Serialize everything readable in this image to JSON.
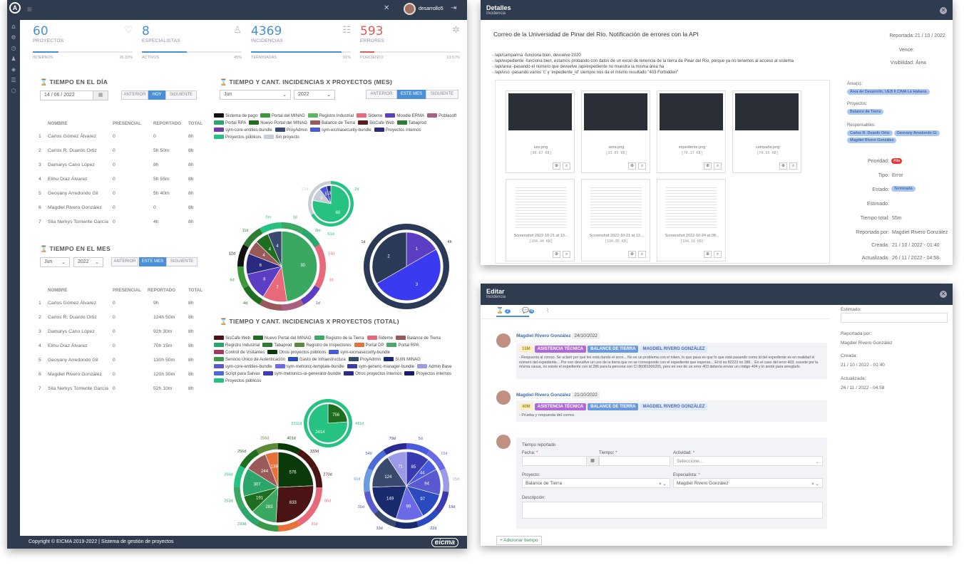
{
  "dashboard": {
    "user": "desarrollo5",
    "stats": [
      {
        "value": "60",
        "label": "PROYECTOS",
        "sub": "INTERNOS",
        "pct": "26.33%",
        "fill": 0.26,
        "icon": "heart-hand-icon"
      },
      {
        "value": "8",
        "label": "ESPECIALISTAS",
        "sub": "ACTIVOS",
        "pct": "45%",
        "fill": 0.45,
        "icon": "user-icon"
      },
      {
        "value": "4369",
        "label": "INCIDENCIAS",
        "sub": "TERMINADAS",
        "pct": "91%",
        "fill": 0.91,
        "icon": "list-icon"
      },
      {
        "value": "593",
        "label": "ERRORES",
        "sub": "PORCIENTO",
        "pct": "13.57%",
        "fill": 0.14,
        "icon": "bug-icon"
      }
    ],
    "day": {
      "title": "TIEMPO EN EL DÍA",
      "date": "14 / 06 / 2022",
      "prev": "ANTERIOR",
      "today": "HOY",
      "next": "SIGUIENTE",
      "headers": [
        "NOMBRE",
        "PRESENCIAL",
        "REPORTADO",
        "TOTAL"
      ],
      "rows": [
        [
          "1",
          "Carlos Gómez Álvarez",
          "0",
          "0",
          "8h"
        ],
        [
          "2",
          "Carlos R. Duardo Ortiz",
          "0",
          "5h 50m",
          "8h"
        ],
        [
          "3",
          "Damarys Cano López",
          "0",
          "8h",
          "8h"
        ],
        [
          "4",
          "Elihu Díaz Álvarez",
          "0",
          "5h 55m",
          "8h"
        ],
        [
          "5",
          "Geovany Arredondo Gil",
          "0",
          "5h 40m",
          "8h"
        ],
        [
          "6",
          "Magdiel Rivero González",
          "0",
          "0",
          "8h"
        ],
        [
          "7",
          "Sila Nerkys Torriente García",
          "0",
          "4h",
          "8h"
        ]
      ]
    },
    "month": {
      "title": "TIEMPO EN EL MES",
      "month": "Jun",
      "year": "2022",
      "prev": "ANTERIOR",
      "cur": "ESTE MES",
      "next": "SIGUIENTE",
      "headers": [
        "NOMBRE",
        "PRESENCIAL",
        "REPORTADO",
        "TOTAL"
      ],
      "rows": [
        [
          "1",
          "Carlos Gómez Álvarez",
          "0",
          "9h",
          "8h"
        ],
        [
          "2",
          "Carlos R. Duardo Ortiz",
          "0",
          "124h 50m",
          "8h"
        ],
        [
          "3",
          "Damarys Cano López",
          "0",
          "92h 30m",
          "8h"
        ],
        [
          "4",
          "Elihu Díaz Álvarez",
          "0",
          "70h 15m",
          "8h"
        ],
        [
          "5",
          "Geovany Arredondo Gil",
          "0",
          "130h 50m",
          "8h"
        ],
        [
          "6",
          "Magdiel Rivero González",
          "0",
          "120h 30m",
          "8h"
        ],
        [
          "7",
          "Sila Nerkys Torriente García",
          "0",
          "52h 10m",
          "8h"
        ]
      ]
    },
    "chart_mes": {
      "title": "TIEMPO Y CANT. INCIDENCIAS X PROYECTOS (MES)",
      "month": "Jun",
      "year": "2022",
      "prev": "ANTERIOR",
      "cur": "ESTE MES",
      "next": "SIGUIENTE",
      "legend": [
        [
          "Sistema de pago",
          "#111111"
        ],
        [
          "Portal del MINAG",
          "#3a9a3a"
        ],
        [
          "Registro Industrial",
          "#5cb85c"
        ],
        [
          "Sideme",
          "#e86a7a"
        ],
        [
          "Moodle ERMA",
          "#5b3ec4"
        ],
        [
          "Poblasoft",
          "#a86080"
        ],
        [
          "Portal RPA",
          "#2ca56a"
        ],
        [
          "Nuevo Portal del MINAG",
          "#1f6e1f"
        ],
        [
          "Balance de Tierra",
          "#9a5a5a"
        ],
        [
          "SisCafe Web",
          "#5a1e1e"
        ],
        [
          "Tabaprod",
          "#2e7d32"
        ],
        [
          "sym-core-entities-bundle",
          "#6a3ab0"
        ],
        [
          "ProyAdmin",
          "#3a4a6e"
        ],
        [
          "sym-eicmasecurity-bundle",
          "#4a5adf"
        ],
        [
          "Proyectos internos",
          "#2a2a80"
        ],
        [
          "Proyectos públicos",
          "#26c281"
        ],
        [
          "Sin proyecto",
          "#c8cdd6"
        ]
      ]
    },
    "chart_total": {
      "title": "TIEMPO Y CANT. INCIDENCIAS X PROYECTOS (TOTAL)",
      "legend": [
        [
          "SisCafe Web",
          "#4a1414"
        ],
        [
          "Nuevo Portal del MINAG",
          "#1f6e1f"
        ],
        [
          "Registro de la Tierra",
          "#3aa860"
        ],
        [
          "Sideme",
          "#e86a7a"
        ],
        [
          "Balance de Tierra",
          "#9a5a5a"
        ],
        [
          "Registro Industrial",
          "#2ca56a"
        ],
        [
          "Tabaprod",
          "#2e7d32"
        ],
        [
          "Registro de Inspectores",
          "#5a8a3a"
        ],
        [
          "Portal DP",
          "#e8703a"
        ],
        [
          "Portal RPA",
          "#4aa86a"
        ],
        [
          "Control de Visitantes",
          "#a03a5a"
        ],
        [
          "Otros proyectos públicos",
          "#0a3a0a"
        ],
        [
          "sym-eicmasecurity-bundle",
          "#4a5adf"
        ],
        [
          "Servicio Único de Autenticación",
          "#3a9a4a"
        ],
        [
          "Gasto de Infraestructura",
          "#2a4ac0"
        ],
        [
          "ProyAdmin",
          "#3a4a6e"
        ],
        [
          "SUIN MINAG",
          "#1a2a6e"
        ],
        [
          "sym-core-entities-bundle",
          "#5a5ad0"
        ],
        [
          "sym-metronic-template-bundle",
          "#6a6ae8"
        ],
        [
          "sym-generic-manager-bundle",
          "#3a3ab0"
        ],
        [
          "Admin Base",
          "#9a9ae8"
        ],
        [
          "Script para Salvas",
          "#4a6ad8"
        ],
        [
          "sym-metronics-ui-generator-bundle",
          "#3a3ac0"
        ],
        [
          "Otros proyectos internos",
          "#2a2a90"
        ],
        [
          "Proyectos internos",
          "#1a1a70"
        ],
        [
          "Proyectos públicos",
          "#26c281"
        ]
      ]
    },
    "pies_mes": {
      "small": {
        "inner": "60",
        "labels": [
          "2d",
          "51d",
          "21d"
        ]
      },
      "left": {
        "inner": [
          "30",
          "7",
          "8",
          "6",
          "4",
          "4",
          "4"
        ],
        "labels": [
          "1d",
          "0m",
          "14d",
          "3d",
          "1d",
          "2d",
          "6d",
          "4d",
          "6d",
          "12d",
          "11d",
          "0m"
        ]
      },
      "right": {
        "inner": [
          "1",
          "3",
          "2"
        ],
        "labels": [
          "4h",
          "0m",
          "1d"
        ]
      }
    },
    "pies_total": {
      "small": {
        "inner": [
          "756",
          "2414"
        ],
        "labels": [
          "411d",
          "2311d"
        ]
      },
      "left": {
        "inner": [
          "576",
          "633",
          "283",
          "191",
          "307",
          "244",
          "139"
        ],
        "labels": [
          "401d",
          "333d",
          "270d",
          "86d",
          "91d",
          "118d",
          "145d",
          "233d",
          "253d",
          "266d",
          "256d",
          "256d"
        ]
      },
      "right": {
        "inner": [
          "85",
          "44",
          "94",
          "97",
          "99",
          "149",
          "124",
          "71"
        ],
        "labels": [
          "5d",
          "15d",
          "15d",
          "19d",
          "22d",
          "28d",
          "33d",
          "30d",
          "60d",
          "54d",
          "79d"
        ]
      }
    },
    "footer": "Copyright © EICMA 2019-2022 | Sistema de gestión de proyectos",
    "brand": "eicma"
  },
  "detalles": {
    "title": "Detalles",
    "subtitle": "Incidencia",
    "heading": "Correo de la Universidad de Pinar del Río. Notificación de errores con la API",
    "body": [
      "- /api/campanna -funciona bien, devuelve 2020",
      "- /api/expediente -funciona bien, estamos probando con datos de un excel de tenencia de la tierra de Pinar del Río, porque ya no tenemos al acceso al sistema",
      "- /api/area -pasando el número que devuelve /api/expediente no muestra la misma área ha",
      "- /api/uso -pasando varios 'c' y 'expediente_id' siempre nos da el mismo resultado \"403 Forbidden\""
    ],
    "files": [
      [
        "uso.png",
        "[90.67 KB]"
      ],
      [
        "area.png",
        "[33.05 KB]"
      ],
      [
        "expediente.png",
        "[70.17 KB]"
      ],
      [
        "campaña.png",
        "[70.65 KB]"
      ],
      [
        "Screenshot 2022-10-21 at 13...",
        "[104.44 KB]"
      ],
      [
        "Screenshot 2022-10-21 at 13...",
        "[100.85 KB]"
      ],
      [
        "Screenshot 2022-10-24 at 08...",
        "[104.16 KB]"
      ]
    ],
    "side": {
      "reportada_l": "Reportada:",
      "reportada": "21 / 10 / 2022",
      "vence_l": "Vence:",
      "visib_l": "Visibilidad:",
      "visib": "Área",
      "area_l": "Área(s):",
      "area": "Área de Desarrollo, UEB ll CIMA La Habana",
      "proy_l": "Proyectos:",
      "proy": "Balance de Tierra",
      "resp_l": "Responsables:",
      "resp": [
        "Carlos R. Duardo Ortiz",
        "Geovany Arredondo Gi",
        "Magdiel Rivero González"
      ],
      "prio_l": "Prioridad:",
      "prio": "Alta",
      "tipo_l": "Tipo:",
      "tipo": "Error",
      "estado_l": "Estado:",
      "estado": "Terminada",
      "estim_l": "Estimado:",
      "ttotal_l": "Tiempo total:",
      "ttotal": "55m",
      "repp_l": "Reportada por:",
      "repp": "Magdiel Rivero González",
      "creada_l": "Creada:",
      "creada": "21 / 10 / 2022 - 01:40",
      "act_l": "Actualizada:",
      "act": "26 / 11 / 2022 - 04:58"
    }
  },
  "editar": {
    "title": "Editar",
    "subtitle": "Incidencia",
    "tab1_count": "2",
    "tab2_count": "4",
    "comments": [
      {
        "author": "Magdiel Rivero González",
        "date": "24/10/2022",
        "time": "15M",
        "tag1": "ASISTENCIA TÉCNICA",
        "tag2": "BALANCE DE TIERRA",
        "tag3": "MAGDIEL RIVERO GONZÁLEZ",
        "text": "- Respuesta al correo. Se aclaró por qué les está dando el error... No es un problema con el token, lo que pasa es que lo que está pasando como id del expediente es en realidad el número del expediente... Por eso devuelve un uso de la tierra que no se corresponde con el expediente que esperan... El id es 82223 no 286... En el caso del error 403, sucede por la misma causa, no existe el expediente con id 286 para la persona con CI 86081006265, pero en vez de un error 403 debería enviar un código 404 y lo anoté para arreglarlo."
      },
      {
        "author": "Magdiel Rivero González",
        "date": "21/10/2022",
        "time": "40M",
        "tag1": "ASISTENCIA TÉCNICA",
        "tag2": "BALANCE DE TIERRA",
        "tag3": "MAGDIEL RIVERO GONZÁLEZ",
        "text": "- Prueba y respuesta del correo."
      }
    ],
    "form": {
      "title": "Tiempo reportado",
      "fecha": "Fecha:",
      "tiempo": "Tiempo:",
      "actividad": "Actividad:",
      "actividad_ph": "Seleccione...",
      "proyecto": "Proyecto:",
      "proyecto_v": "Balance de Tierra",
      "especialista": "Especialista:",
      "especialista_v": "Magdiel Rivero González",
      "descripcion": "Descripción:",
      "add": "+ Adicionar tiempo"
    },
    "side": {
      "estim_l": "Estimado:",
      "repp_l": "Reportada por:",
      "repp": "Magdiel Rivero González",
      "creada_l": "Creada:",
      "creada": "21 / 10 / 2022 - 01:40",
      "act_l": "Actualizada:",
      "act": "26 / 11 / 2022 - 04:58"
    }
  }
}
